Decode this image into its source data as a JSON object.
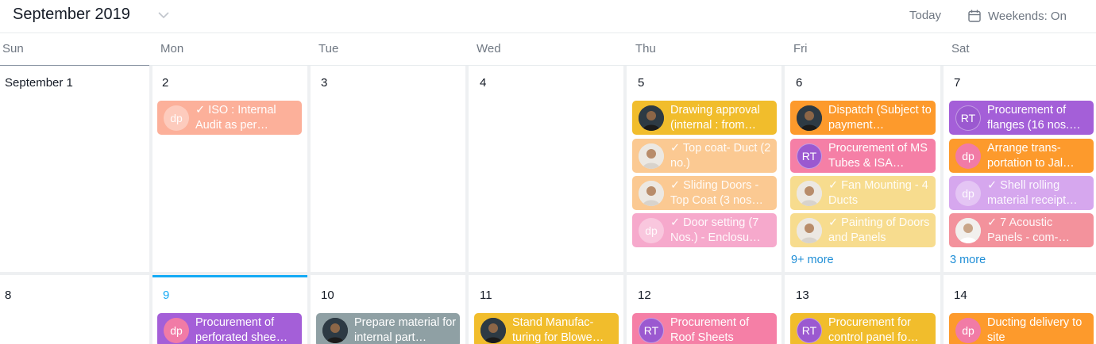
{
  "header": {
    "month_title": "September 2019",
    "today_label": "Today",
    "weekends_label": "Weekends: On"
  },
  "days_of_week": [
    "Sun",
    "Mon",
    "Tue",
    "Wed",
    "Thu",
    "Fri",
    "Sat"
  ],
  "week1": {
    "day_numbers": [
      "September 1",
      "2",
      "3",
      "4",
      "5",
      "6",
      "7"
    ],
    "tasks": {
      "mon": [
        {
          "text": "✓ ISO : Internal Audit as per…",
          "avatar": "dp",
          "color": "#fcb09a"
        }
      ],
      "thu": [
        {
          "text": "Drawing approval (internal : from…",
          "avatar": "photo",
          "color": "#f1bd2c"
        },
        {
          "text": "✓ Top coat- Duct (2 no.)",
          "avatar": "photo",
          "color": "#fbc992"
        },
        {
          "text": "✓ Sliding Doors - Top Coat (3 nos…",
          "avatar": "photo",
          "color": "#fbc992"
        },
        {
          "text": "✓ Door setting (7 Nos.) - Enclosu…",
          "avatar": "dp",
          "color": "#f6a9cc"
        }
      ],
      "fri": [
        {
          "text": "Dispatch (Subject to payment…",
          "avatar": "photo",
          "color": "#fd9a2c"
        },
        {
          "text": "Procurement of MS Tubes & ISA…",
          "avatar": "RT",
          "color": "#f57fa6"
        },
        {
          "text": "✓ Fan Mounting - 4 Ducts",
          "avatar": "photo",
          "color": "#f7dc8e"
        },
        {
          "text": "✓ Painting of Doors and Panels",
          "avatar": "photo",
          "color": "#f7dc8e"
        }
      ],
      "sat": [
        {
          "text": "Procurement of flanges (16 nos.…",
          "avatar": "RT",
          "color": "#a45fd8"
        },
        {
          "text": "Arrange trans- portation to Jal…",
          "avatar": "dp",
          "color": "#fd9a2c"
        },
        {
          "text": "✓ Shell rolling material receipt…",
          "avatar": "dp",
          "color": "#d6a7ee"
        },
        {
          "text": "✓ 7 Acoustic Panels - com-…",
          "avatar": "photo",
          "color": "#f3929c"
        }
      ]
    },
    "more": {
      "fri": "9+ more",
      "sat": "3 more"
    }
  },
  "week2": {
    "day_numbers": [
      "8",
      "9",
      "10",
      "11",
      "12",
      "13",
      "14"
    ],
    "tasks": {
      "mon": {
        "text": "Procurement of perforated shee…",
        "avatar": "dp",
        "color": "#a45fd8"
      },
      "tue": {
        "text": "Prepare material for internal part…",
        "avatar": "photo",
        "color": "#8fa0a4"
      },
      "wed": {
        "text": "Stand Manufac- turing for Blowe…",
        "avatar": "photo",
        "color": "#f1bd2c"
      },
      "thu": {
        "text": "Procurement of Roof Sheets",
        "avatar": "RT",
        "color": "#f57fa6"
      },
      "fri": {
        "text": "Procurement for control panel fo…",
        "avatar": "RT",
        "color": "#f1bd2c"
      },
      "sat": {
        "text": "Ducting delivery to site",
        "avatar": "dp",
        "color": "#fd9a2c"
      }
    }
  }
}
